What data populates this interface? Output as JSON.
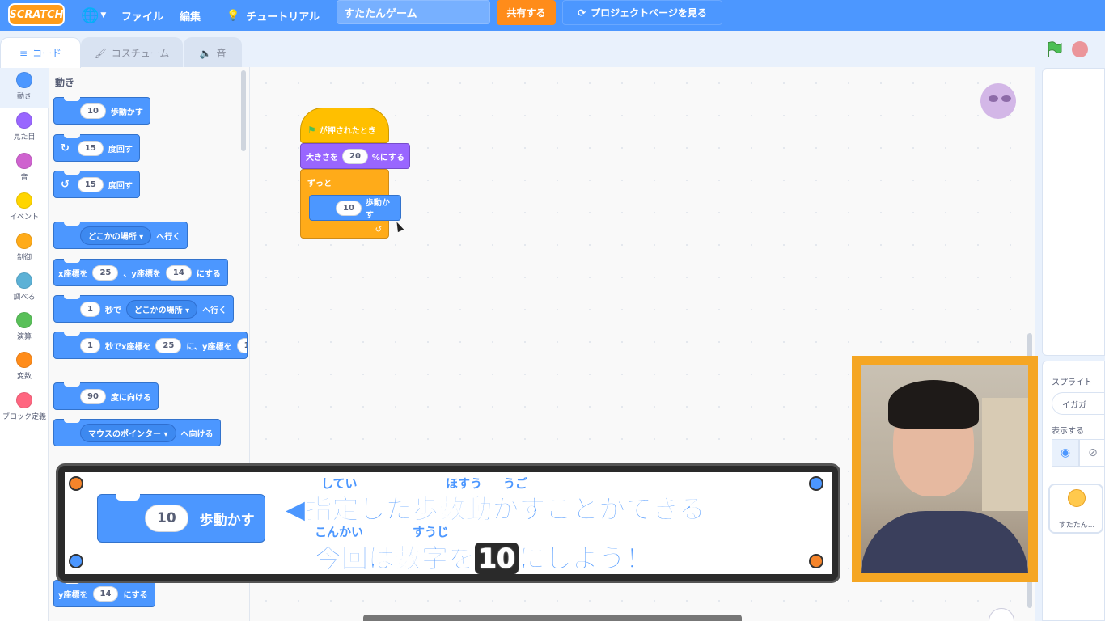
{
  "menubar": {
    "logo": "SCRATCH",
    "file": "ファイル",
    "edit": "編集",
    "tutorials": "チュートリアル",
    "project_title": "すたたんゲーム",
    "share": "共有する",
    "project_page": "プロジェクトページを見る"
  },
  "tabs": {
    "code": "コード",
    "costumes": "コスチューム",
    "sounds": "音"
  },
  "categories": [
    {
      "label": "動き",
      "color": "#4c97ff"
    },
    {
      "label": "見た目",
      "color": "#9966ff"
    },
    {
      "label": "音",
      "color": "#cf63cf"
    },
    {
      "label": "イベント",
      "color": "#ffd500"
    },
    {
      "label": "制御",
      "color": "#ffab19"
    },
    {
      "label": "調べる",
      "color": "#5cb1d6"
    },
    {
      "label": "演算",
      "color": "#59c059"
    },
    {
      "label": "変数",
      "color": "#ff8c1a"
    },
    {
      "label": "ブロック定義",
      "color": "#ff6680"
    }
  ],
  "palette": {
    "title": "動き",
    "move": {
      "value": "10",
      "text": "歩動かす"
    },
    "turn_right": {
      "value": "15",
      "text": "度回す"
    },
    "turn_left": {
      "value": "15",
      "text": "度回す"
    },
    "goto": {
      "menu": "どこかの場所",
      "text": "へ行く"
    },
    "goto_xy": {
      "t1": "x座標を",
      "x": "25",
      "t2": "、y座標を",
      "y": "14",
      "t3": "にする"
    },
    "glide": {
      "secs": "1",
      "t1": "秒で",
      "menu": "どこかの場所",
      "t2": "へ行く"
    },
    "glide_xy": {
      "secs": "1",
      "t1": "秒でx座標を",
      "x": "25",
      "t2": "に、y座標を",
      "y": "1"
    },
    "point_dir": {
      "value": "90",
      "text": "度に向ける"
    },
    "point_towards": {
      "menu": "マウスのポインター",
      "text": "へ向ける"
    },
    "set_y": {
      "t1": "y座標を",
      "y": "14",
      "t2": "にする"
    }
  },
  "script": {
    "hat": "が押されたとき",
    "size": {
      "t1": "大きさを",
      "value": "20",
      "t2": "%にする"
    },
    "forever": "ずっと",
    "move": {
      "value": "10",
      "text": "歩動かす"
    }
  },
  "sprite_panel": {
    "sprite_label": "スプライト",
    "sprite_name": "イガガ",
    "show_label": "表示する",
    "thumb_name": "すたたん..."
  },
  "caption": {
    "block_value": "10",
    "block_text": "歩動かす",
    "line1": "◀指定した歩数動かすことができる",
    "line2_a": "今回は数字を",
    "line2_num": "10",
    "line2_b": "にしよう！",
    "ruby_shitei": "してい",
    "ruby_hosuu": "ほすう",
    "ruby_ugo": "うご",
    "ruby_konkai": "こんかい",
    "ruby_suuji": "すうじ"
  }
}
